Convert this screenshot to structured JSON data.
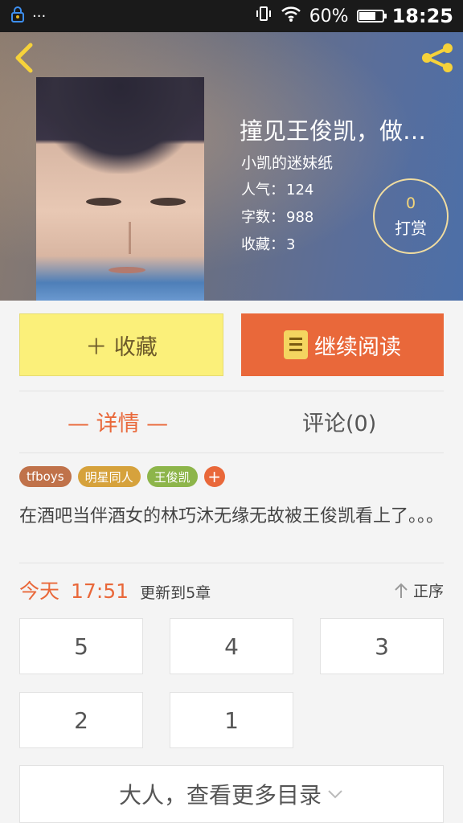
{
  "status_bar": {
    "battery": "60%",
    "time": "18:25",
    "dots": "···"
  },
  "book": {
    "title": "撞见王俊凯，做…",
    "author": "小凯的迷妹纸",
    "stats": [
      {
        "label": "人气：",
        "value": "124"
      },
      {
        "label": "字数：",
        "value": "988"
      },
      {
        "label": "收藏：",
        "value": "3"
      }
    ],
    "tip": {
      "count": "0",
      "label": "打赏"
    }
  },
  "actions": {
    "favorite_label": "＋ 收藏",
    "read_label": "继续阅读"
  },
  "tabs": {
    "detail": "— 详情 —",
    "comments": "评论(0)"
  },
  "tags": [
    {
      "label": "tfboys",
      "color": "#c0724a"
    },
    {
      "label": "明星同人",
      "color": "#d6a23c"
    },
    {
      "label": "王俊凯",
      "color": "#8db54a"
    }
  ],
  "tag_add": "+",
  "summary": "在酒吧当伴酒女的林巧沐无缘无故被王俊凯看上了。。。",
  "update": {
    "day": "今天",
    "time": "17:51",
    "text": "更新到5章",
    "order_label": "正序"
  },
  "chapters": [
    "5",
    "4",
    "3",
    "2",
    "1"
  ],
  "more_label": "大人，查看更多目录",
  "colors": {
    "accent": "#e9683a",
    "favorite_bg": "#fbf07a"
  }
}
